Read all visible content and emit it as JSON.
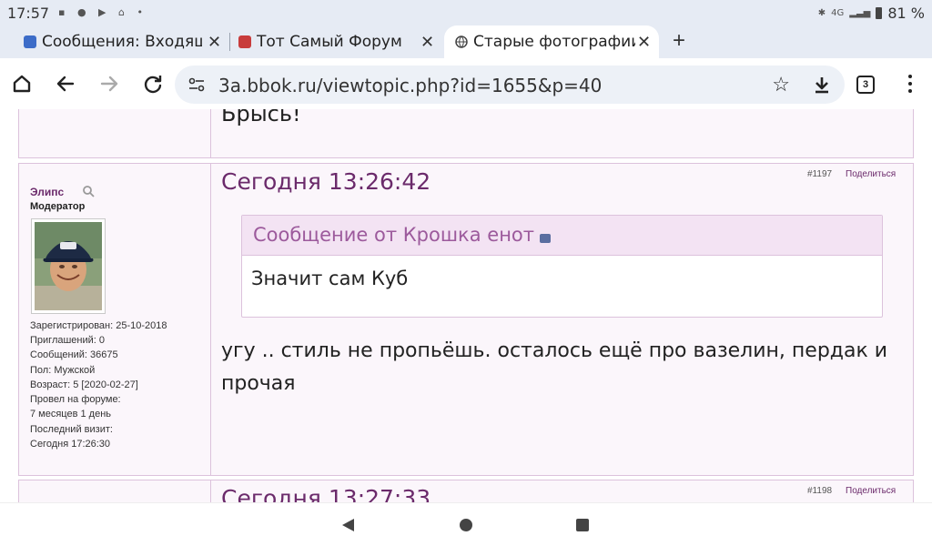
{
  "status_bar": {
    "time": "17:57",
    "icons_left": "▪ ● ▶ ⌂ •",
    "network": "4G",
    "battery": "81 %"
  },
  "tabs": [
    {
      "title": "Сообщения: Входящ",
      "close": "✕"
    },
    {
      "title": "Тот Самый Форум",
      "close": "✕"
    },
    {
      "title": "Старые фотографии",
      "close": "✕"
    }
  ],
  "new_tab": "+",
  "omnibox": {
    "url": "3a.bbok.ru/viewtopic.php?id=1655&p=40",
    "tab_count": "3"
  },
  "colors": {
    "accent": "#6b2a6b",
    "post_bg": "#fbf6fb",
    "border": "#dcc2dc",
    "quote_head": "#f3e3f3"
  },
  "prev_post": {
    "text": "Брысь!"
  },
  "post": {
    "author": "Элипс",
    "role": "Модератор",
    "info": [
      "Зарегистрирован: 25-10-2018",
      "Приглашений: 0",
      "Сообщений: 36675",
      "Пол: Мужской",
      "Возраст: 5 [2020-02-27]",
      "Провел на форуме:",
      "7 месяцев 1 день",
      "Последний визит:",
      "Сегодня 17:26:30"
    ],
    "time": "Сегодня 13:26:42",
    "number": "#1197",
    "share": "Поделиться",
    "quote_header": "Сообщение от Крошка енот",
    "quote_body": "Значит сам Куб",
    "text": "угу .. стиль не пропьёшь.  осталось ещё про вазелин, пердак и прочая"
  },
  "next_post": {
    "time": "Сегодня 13:27:33",
    "number": "#1198",
    "share": "Поделиться"
  }
}
